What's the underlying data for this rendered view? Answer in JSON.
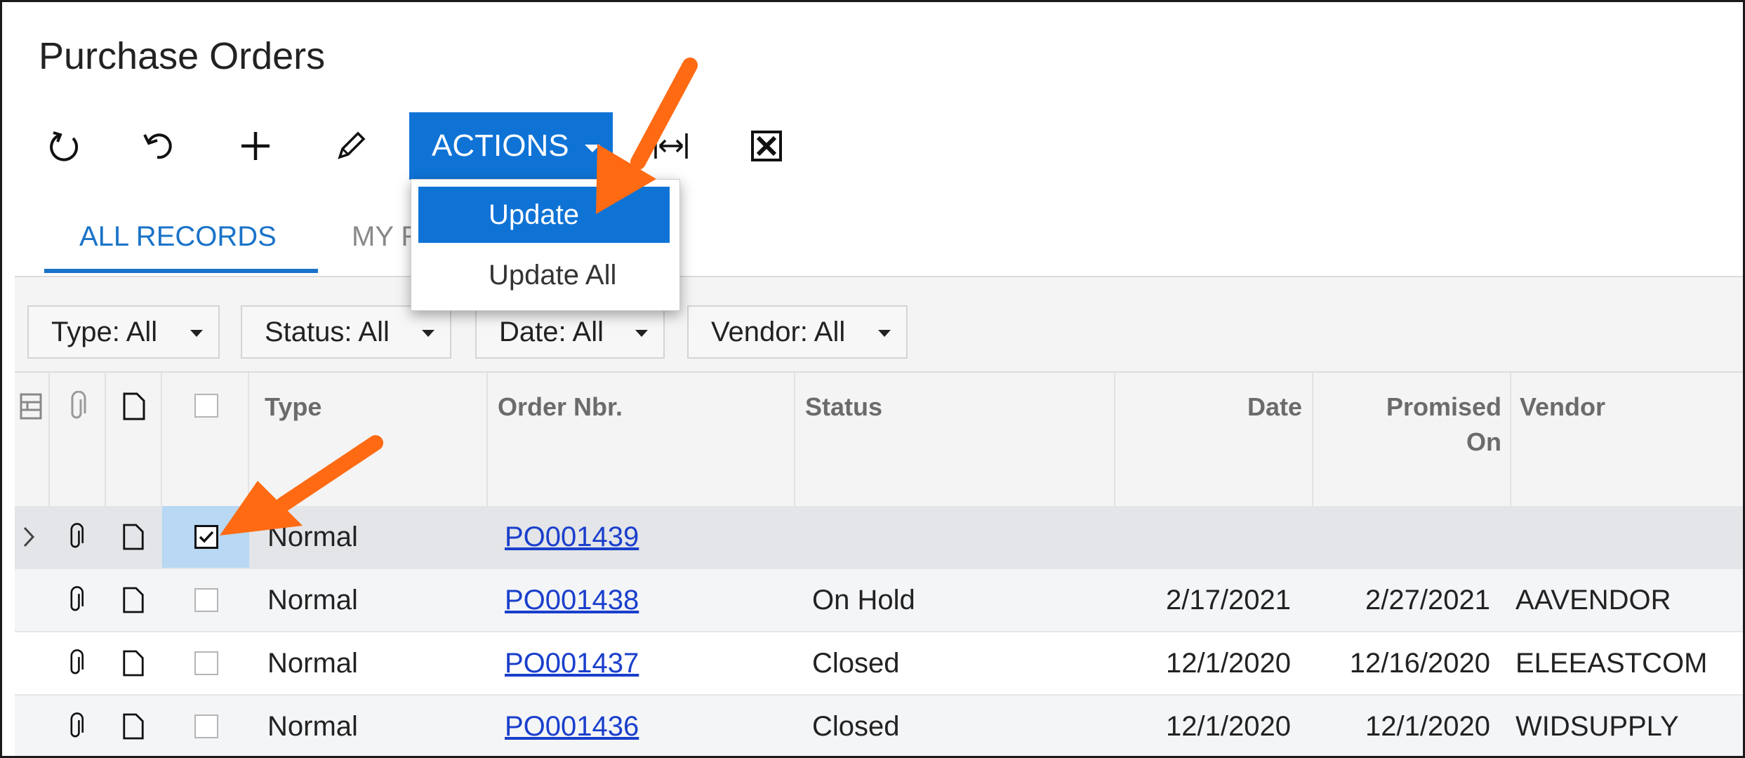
{
  "page": {
    "title": "Purchase Orders"
  },
  "toolbar": {
    "refresh_icon": "refresh-icon",
    "undo_icon": "undo-icon",
    "add_icon": "plus-icon",
    "edit_icon": "pencil-icon",
    "actions_label": "ACTIONS",
    "fit_icon": "fit-columns-icon",
    "excel_icon": "excel-export-icon"
  },
  "actions_menu": {
    "items": [
      "Update",
      "Update All"
    ],
    "highlighted": "Update"
  },
  "tabs": [
    {
      "label": "ALL RECORDS",
      "active": true
    },
    {
      "label": "MY R",
      "active": false
    }
  ],
  "filters": [
    "Type: All",
    "Status: All",
    "Date: All",
    "Vendor: All"
  ],
  "grid": {
    "columns": [
      "Type",
      "Order Nbr.",
      "Status",
      "Date",
      "Promised On",
      "Vendor"
    ],
    "rows": [
      {
        "checked": true,
        "type": "Normal",
        "order_nbr": "PO001439",
        "status": "",
        "date": "",
        "promised_on": "",
        "vendor": ""
      },
      {
        "checked": false,
        "type": "Normal",
        "order_nbr": "PO001438",
        "status": "On Hold",
        "date": "2/17/2021",
        "promised_on": "2/27/2021",
        "vendor": "AAVENDOR"
      },
      {
        "checked": false,
        "type": "Normal",
        "order_nbr": "PO001437",
        "status": "Closed",
        "date": "12/1/2020",
        "promised_on": "12/16/2020",
        "vendor": "ELEEASTCOM"
      },
      {
        "checked": false,
        "type": "Normal",
        "order_nbr": "PO001436",
        "status": "Closed",
        "date": "12/1/2020",
        "promised_on": "12/1/2020",
        "vendor": "WIDSUPPLY"
      }
    ]
  },
  "colors": {
    "accent": "#0f73d6",
    "tab_active": "#1a73c8",
    "link": "#1a3fcc",
    "callout_arrow": "#ff6a13"
  }
}
